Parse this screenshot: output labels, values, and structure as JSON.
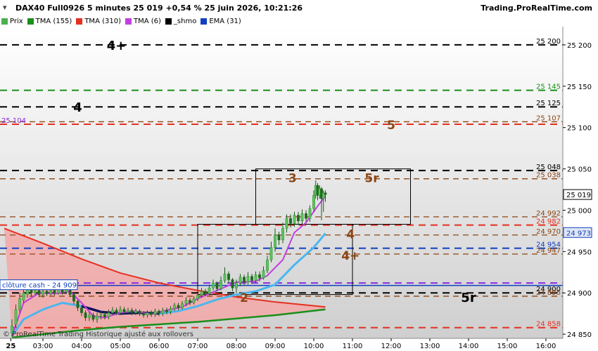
{
  "header": {
    "title": "DAX40 Full0926 5 minutes 25 019 +0,54 % 25 juin 2026, 10:21:26",
    "brand": "Trading.ProRealTime.com"
  },
  "legend": [
    {
      "label": "Prix",
      "color": "#4caf50"
    },
    {
      "label": "TMA (155)",
      "color": "#1a8f1a"
    },
    {
      "label": "TMA (310)",
      "color": "#e53020"
    },
    {
      "label": "TMA (6)",
      "color": "#c040e0"
    },
    {
      "label": "_shmo",
      "color": "#000000"
    },
    {
      "label": "EMA (31)",
      "color": "#1040c0"
    }
  ],
  "footer": "© ProRealTime Trading  Historique ajusté aux rollovers",
  "close_label": "clôture cash - 24 909",
  "left_label": "25 104",
  "chart_data": {
    "type": "candlestick",
    "ylim": [
      24845,
      25222
    ],
    "x_ticks": [
      "25",
      "03:00",
      "04:00",
      "05:00",
      "06:00",
      "07:00",
      "08:00",
      "09:00",
      "10:00",
      "11:00",
      "12:00",
      "13:00",
      "14:00",
      "15:00",
      "16:00"
    ],
    "x_tick_hours": [
      2.17,
      3,
      4,
      5,
      6,
      7,
      8,
      9,
      10,
      11,
      12,
      13,
      14,
      15,
      16
    ],
    "y_ticks": [
      24850,
      24900,
      24950,
      25000,
      25050,
      25100,
      25150,
      25200
    ],
    "y_tick_labels": [
      "24 850",
      "24 900",
      "24 950",
      "25 000",
      "25 050",
      "25 100",
      "25 150",
      "25 200"
    ],
    "last_price": {
      "value": 25019,
      "label": "25 019"
    },
    "ema_tag": {
      "value": 24973,
      "label": "24 973",
      "color": "#1040c0"
    },
    "levels": [
      {
        "value": 25200,
        "label": "25 200",
        "color": "#000000"
      },
      {
        "value": 25145,
        "label": "25 145",
        "color": "#1a8f1a"
      },
      {
        "value": 25125,
        "label": "25 125",
        "color": "#000000"
      },
      {
        "value": 25107,
        "label": "25 107",
        "color": "#8b4513"
      },
      {
        "value": 25104,
        "label": "25 104",
        "color": "#e53020"
      },
      {
        "value": 25048,
        "label": "25 048",
        "color": "#000000"
      },
      {
        "value": 25038,
        "label": "25 038",
        "color": "#8b4513"
      },
      {
        "value": 24992,
        "label": "24 992",
        "color": "#8b4513"
      },
      {
        "value": 24982,
        "label": "24 982",
        "color": "#e53020"
      },
      {
        "value": 24970,
        "label": "24 970",
        "color": "#8b4513"
      },
      {
        "value": 24954,
        "label": "24 954",
        "color": "#1040c0"
      },
      {
        "value": 24947,
        "label": "24 947",
        "color": "#8b4513"
      },
      {
        "value": 24912,
        "label": "",
        "color": "#8a2be2"
      },
      {
        "value": 24900,
        "label": "24 900",
        "color": "#000000"
      },
      {
        "value": 24896,
        "label": "24 896",
        "color": "#8b4513"
      },
      {
        "value": 24858,
        "label": "24 858",
        "color": "#e53020"
      }
    ],
    "close_level": 24909,
    "annotations": [
      {
        "text": "4+",
        "x": 4.9,
        "y": 25200,
        "color": "#000000",
        "size": 18
      },
      {
        "text": "4",
        "x": 3.9,
        "y": 25125,
        "color": "#000000",
        "size": 18
      },
      {
        "text": "5",
        "x": 12.0,
        "y": 25104,
        "color": "#8b4513",
        "size": 17
      },
      {
        "text": "3",
        "x": 9.45,
        "y": 25040,
        "color": "#8b4513",
        "size": 17
      },
      {
        "text": "5r",
        "x": 11.5,
        "y": 25040,
        "color": "#8b4513",
        "size": 17
      },
      {
        "text": "4",
        "x": 10.95,
        "y": 24972,
        "color": "#8b4513",
        "size": 17
      },
      {
        "text": "4+",
        "x": 10.95,
        "y": 24946,
        "color": "#8b4513",
        "size": 17
      },
      {
        "text": "2",
        "x": 8.2,
        "y": 24895,
        "color": "#8b4513",
        "size": 17
      },
      {
        "text": "5r",
        "x": 14.0,
        "y": 24895,
        "color": "#000000",
        "size": 18
      }
    ],
    "boxes": [
      {
        "x0": 7.0,
        "x1": 11.0,
        "y0": 24898,
        "y1": 24983
      },
      {
        "x0": 8.5,
        "x1": 12.5,
        "y0": 24983,
        "y1": 25050
      }
    ],
    "tma310": [
      [
        2.0,
        24978
      ],
      [
        3.0,
        24960
      ],
      [
        4.0,
        24941
      ],
      [
        5.0,
        24924
      ],
      [
        6.0,
        24912
      ],
      [
        7.0,
        24903
      ],
      [
        8.0,
        24895
      ],
      [
        9.0,
        24889
      ],
      [
        10.3,
        24883
      ]
    ],
    "tma155": [
      [
        2.2,
        24846
      ],
      [
        3.0,
        24850
      ],
      [
        4.0,
        24855
      ],
      [
        5.0,
        24859
      ],
      [
        6.0,
        24862
      ],
      [
        7.0,
        24865
      ],
      [
        8.0,
        24869
      ],
      [
        9.0,
        24873
      ],
      [
        10.3,
        24880
      ]
    ],
    "ema31": [
      [
        2.2,
        24848
      ],
      [
        2.5,
        24868
      ],
      [
        3.0,
        24880
      ],
      [
        3.5,
        24888
      ],
      [
        4.0,
        24884
      ],
      [
        4.5,
        24877
      ],
      [
        5.0,
        24875
      ],
      [
        5.5,
        24876
      ],
      [
        6.0,
        24875
      ],
      [
        6.5,
        24878
      ],
      [
        7.0,
        24884
      ],
      [
        7.5,
        24892
      ],
      [
        8.0,
        24898
      ],
      [
        8.5,
        24902
      ],
      [
        9.0,
        24910
      ],
      [
        9.5,
        24934
      ],
      [
        10.0,
        24955
      ],
      [
        10.3,
        24972
      ]
    ],
    "tma6": [
      [
        2.2,
        24848
      ],
      [
        2.5,
        24888
      ],
      [
        2.9,
        24900
      ],
      [
        3.3,
        24899
      ],
      [
        3.7,
        24902
      ],
      [
        4.0,
        24888
      ],
      [
        4.3,
        24872
      ],
      [
        4.6,
        24870
      ],
      [
        5.0,
        24876
      ],
      [
        5.4,
        24878
      ],
      [
        5.8,
        24874
      ],
      [
        6.2,
        24879
      ],
      [
        6.6,
        24883
      ],
      [
        7.0,
        24893
      ],
      [
        7.5,
        24903
      ],
      [
        8.0,
        24913
      ],
      [
        8.5,
        24914
      ],
      [
        8.8,
        24921
      ],
      [
        9.2,
        24940
      ],
      [
        9.5,
        24973
      ],
      [
        9.8,
        24985
      ],
      [
        10.1,
        25005
      ],
      [
        10.3,
        25017
      ]
    ],
    "candles": [
      [
        2.2,
        24851,
        24860,
        24847,
        24868
      ],
      [
        2.3,
        24862,
        24880,
        24858,
        24886
      ],
      [
        2.4,
        24880,
        24893,
        24876,
        24900
      ],
      [
        2.5,
        24891,
        24900,
        24888,
        24906
      ],
      [
        2.6,
        24898,
        24906,
        24894,
        24910
      ],
      [
        2.7,
        24904,
        24900,
        24896,
        24908
      ],
      [
        2.8,
        24900,
        24903,
        24897,
        24907
      ],
      [
        2.9,
        24903,
        24898,
        24895,
        24905
      ],
      [
        3.0,
        24898,
        24902,
        24894,
        24906
      ],
      [
        3.1,
        24902,
        24899,
        24896,
        24905
      ],
      [
        3.2,
        24899,
        24903,
        24897,
        24906
      ],
      [
        3.3,
        24903,
        24900,
        24897,
        24905
      ],
      [
        3.4,
        24900,
        24905,
        24898,
        24908
      ],
      [
        3.5,
        24905,
        24901,
        24898,
        24907
      ],
      [
        3.6,
        24901,
        24904,
        24899,
        24907
      ],
      [
        3.7,
        24904,
        24898,
        24895,
        24906
      ],
      [
        3.8,
        24898,
        24890,
        24886,
        24900
      ],
      [
        3.9,
        24890,
        24882,
        24878,
        24892
      ],
      [
        4.0,
        24882,
        24876,
        24872,
        24885
      ],
      [
        4.1,
        24876,
        24870,
        24866,
        24879
      ],
      [
        4.2,
        24870,
        24873,
        24866,
        24877
      ],
      [
        4.3,
        24873,
        24868,
        24865,
        24876
      ],
      [
        4.4,
        24868,
        24872,
        24864,
        24876
      ],
      [
        4.5,
        24872,
        24874,
        24868,
        24878
      ],
      [
        4.6,
        24874,
        24871,
        24868,
        24877
      ],
      [
        4.7,
        24871,
        24876,
        24868,
        24880
      ],
      [
        4.8,
        24876,
        24879,
        24873,
        24883
      ],
      [
        4.9,
        24879,
        24876,
        24873,
        24882
      ],
      [
        5.0,
        24876,
        24880,
        24873,
        24884
      ],
      [
        5.1,
        24880,
        24877,
        24874,
        24883
      ],
      [
        5.2,
        24877,
        24879,
        24874,
        24882
      ],
      [
        5.3,
        24879,
        24876,
        24873,
        24882
      ],
      [
        5.4,
        24876,
        24878,
        24873,
        24881
      ],
      [
        5.5,
        24878,
        24875,
        24872,
        24880
      ],
      [
        5.6,
        24875,
        24873,
        24870,
        24878
      ],
      [
        5.7,
        24873,
        24876,
        24870,
        24879
      ],
      [
        5.8,
        24876,
        24874,
        24871,
        24879
      ],
      [
        5.9,
        24874,
        24878,
        24871,
        24881
      ],
      [
        6.0,
        24878,
        24875,
        24872,
        24880
      ],
      [
        6.1,
        24875,
        24879,
        24872,
        24882
      ],
      [
        6.2,
        24879,
        24877,
        24874,
        24882
      ],
      [
        6.3,
        24877,
        24881,
        24874,
        24884
      ],
      [
        6.4,
        24881,
        24885,
        24878,
        24888
      ],
      [
        6.5,
        24885,
        24882,
        24879,
        24888
      ],
      [
        6.6,
        24882,
        24887,
        24880,
        24890
      ],
      [
        6.7,
        24887,
        24891,
        24884,
        24895
      ],
      [
        6.8,
        24891,
        24888,
        24885,
        24894
      ],
      [
        6.9,
        24888,
        24893,
        24886,
        24896
      ],
      [
        7.0,
        24893,
        24897,
        24890,
        24900
      ],
      [
        7.1,
        24897,
        24902,
        24894,
        24906
      ],
      [
        7.2,
        24902,
        24899,
        24896,
        24905
      ],
      [
        7.3,
        24899,
        24906,
        24897,
        24910
      ],
      [
        7.4,
        24906,
        24912,
        24903,
        24916
      ],
      [
        7.5,
        24912,
        24905,
        24902,
        24914
      ],
      [
        7.6,
        24905,
        24915,
        24903,
        24920
      ],
      [
        7.7,
        24915,
        24923,
        24912,
        24931
      ],
      [
        7.8,
        24923,
        24916,
        24912,
        24926
      ],
      [
        7.9,
        24916,
        24906,
        24902,
        24918
      ],
      [
        8.0,
        24906,
        24912,
        24900,
        24916
      ],
      [
        8.1,
        24912,
        24919,
        24908,
        24923
      ],
      [
        8.2,
        24919,
        24913,
        24909,
        24922
      ],
      [
        8.3,
        24913,
        24920,
        24910,
        24925
      ],
      [
        8.4,
        24920,
        24915,
        24911,
        24923
      ],
      [
        8.5,
        24915,
        24922,
        24912,
        24926
      ],
      [
        8.6,
        24922,
        24918,
        24914,
        24926
      ],
      [
        8.7,
        24918,
        24927,
        24916,
        24932
      ],
      [
        8.8,
        24927,
        24940,
        24924,
        24945
      ],
      [
        8.9,
        24940,
        24955,
        24937,
        24962
      ],
      [
        9.0,
        24955,
        24970,
        24950,
        24978
      ],
      [
        9.1,
        24970,
        24964,
        24958,
        24974
      ],
      [
        9.2,
        24964,
        24978,
        24960,
        24985
      ],
      [
        9.3,
        24978,
        24990,
        24973,
        24995
      ],
      [
        9.4,
        24990,
        24984,
        24979,
        24995
      ],
      [
        9.5,
        24984,
        24994,
        24980,
        24998
      ],
      [
        9.6,
        24994,
        24987,
        24982,
        24998
      ],
      [
        9.7,
        24987,
        24996,
        24983,
        25001
      ],
      [
        9.8,
        24996,
        24990,
        24986,
        25000
      ],
      [
        9.9,
        24990,
        25002,
        24986,
        25006
      ],
      [
        10.0,
        25002,
        25018,
        24998,
        25024
      ],
      [
        10.05,
        25018,
        25030,
        25014,
        25036
      ],
      [
        10.1,
        25030,
        25018,
        25012,
        25033
      ],
      [
        10.15,
        25018,
        25026,
        25014,
        25030
      ],
      [
        10.2,
        25026,
        25014,
        24988,
        25028
      ],
      [
        10.25,
        25014,
        25021,
        24998,
        25024
      ],
      [
        10.3,
        25021,
        25019,
        25010,
        25024
      ]
    ]
  }
}
